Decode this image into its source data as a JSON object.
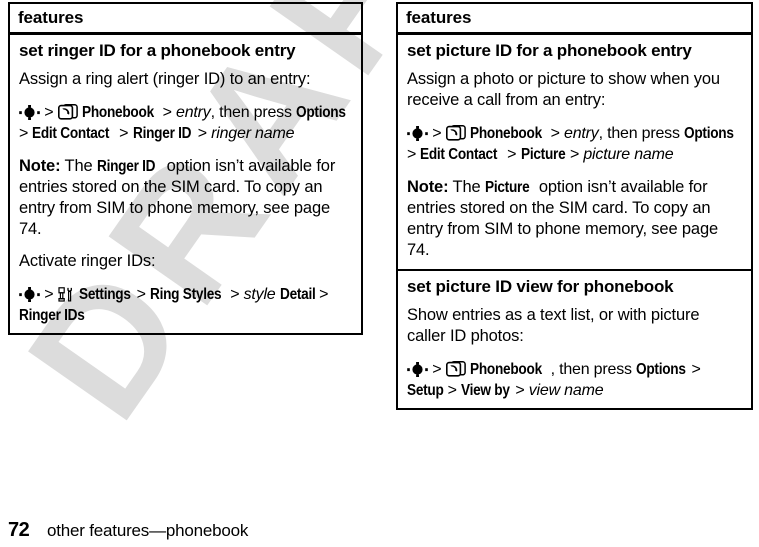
{
  "document": {
    "watermark_text": "DRAFT",
    "watermark_color": "#dcdcdc"
  },
  "footer": {
    "page_number": "72",
    "running_head": "other features—phonebook"
  },
  "columns": [
    {
      "id": "left",
      "header": "features",
      "sections": [
        {
          "title": "set ringer ID for a phonebook entry",
          "blocks": [
            {
              "type": "paragraph",
              "text": "Assign a ring alert (ringer ID) to an entry:"
            },
            {
              "type": "path",
              "icon1": "navigation-key-icon",
              "icon2": "phonebook-icon",
              "segments": [
                {
                  "text": ">",
                  "style": "plain"
                },
                {
                  "text": "Phonebook",
                  "style": "menu"
                },
                {
                  "text": ">",
                  "style": "plain"
                },
                {
                  "text": "entry",
                  "style": "italic"
                },
                {
                  "text": ", then press",
                  "style": "plain"
                },
                {
                  "text": "Options",
                  "style": "menu"
                },
                {
                  "text": ">",
                  "style": "plain"
                },
                {
                  "text": "Edit Contact",
                  "style": "menu"
                },
                {
                  "text": ">",
                  "style": "plain"
                },
                {
                  "text": "Ringer ID",
                  "style": "menu"
                },
                {
                  "text": ">",
                  "style": "plain"
                },
                {
                  "text": "ringer name",
                  "style": "italic"
                }
              ]
            },
            {
              "type": "note",
              "label": "Note:",
              "text_before": " The ",
              "emphasis": "Ringer ID",
              "text_after": " option isn’t available for entries stored on the SIM card. To copy an entry from SIM to phone memory, see page 74."
            },
            {
              "type": "paragraph",
              "text": "Activate ringer IDs:"
            },
            {
              "type": "path",
              "icon1": "navigation-key-icon",
              "icon2": "settings-tools-icon",
              "segments": [
                {
                  "text": ">",
                  "style": "plain"
                },
                {
                  "text": "Settings",
                  "style": "menu"
                },
                {
                  "text": ">",
                  "style": "plain"
                },
                {
                  "text": "Ring Styles",
                  "style": "menu"
                },
                {
                  "text": ">",
                  "style": "plain"
                },
                {
                  "text": "style",
                  "style": "italic"
                },
                {
                  "text": "Detail",
                  "style": "menu"
                },
                {
                  "text": ">",
                  "style": "plain"
                },
                {
                  "text": "Ringer IDs",
                  "style": "menu"
                }
              ]
            }
          ]
        }
      ]
    },
    {
      "id": "right",
      "header": "features",
      "sections": [
        {
          "title": "set picture ID for a phonebook entry",
          "blocks": [
            {
              "type": "paragraph",
              "text": "Assign a photo or picture to show when you receive a call from an entry:"
            },
            {
              "type": "path",
              "icon1": "navigation-key-icon",
              "icon2": "phonebook-icon",
              "segments": [
                {
                  "text": ">",
                  "style": "plain"
                },
                {
                  "text": "Phonebook",
                  "style": "menu"
                },
                {
                  "text": ">",
                  "style": "plain"
                },
                {
                  "text": "entry",
                  "style": "italic"
                },
                {
                  "text": ", then press",
                  "style": "plain"
                },
                {
                  "text": "Options",
                  "style": "menu"
                },
                {
                  "text": ">",
                  "style": "plain"
                },
                {
                  "text": "Edit Contact",
                  "style": "menu"
                },
                {
                  "text": ">",
                  "style": "plain"
                },
                {
                  "text": "Picture",
                  "style": "menu"
                },
                {
                  "text": ">",
                  "style": "plain"
                },
                {
                  "text": "picture name",
                  "style": "italic"
                }
              ]
            },
            {
              "type": "note",
              "label": "Note:",
              "text_before": " The ",
              "emphasis": "Picture",
              "text_after": " option isn’t available for entries stored on the SIM card. To copy an entry from SIM to phone memory, see page 74."
            }
          ]
        },
        {
          "title": "set picture ID view for phonebook",
          "blocks": [
            {
              "type": "paragraph",
              "text": "Show entries as a text list, or with picture caller ID photos:"
            },
            {
              "type": "path",
              "icon1": "navigation-key-icon",
              "icon2": "phonebook-icon",
              "segments": [
                {
                  "text": ">",
                  "style": "plain"
                },
                {
                  "text": "Phonebook",
                  "style": "menu"
                },
                {
                  "text": ", then press",
                  "style": "plain"
                },
                {
                  "text": "Options",
                  "style": "menu"
                },
                {
                  "text": ">",
                  "style": "plain"
                },
                {
                  "text": "Setup",
                  "style": "menu"
                },
                {
                  "text": ">",
                  "style": "plain"
                },
                {
                  "text": "View by",
                  "style": "menu"
                },
                {
                  "text": ">",
                  "style": "plain"
                },
                {
                  "text": "view name",
                  "style": "italic"
                }
              ]
            }
          ]
        }
      ]
    }
  ]
}
